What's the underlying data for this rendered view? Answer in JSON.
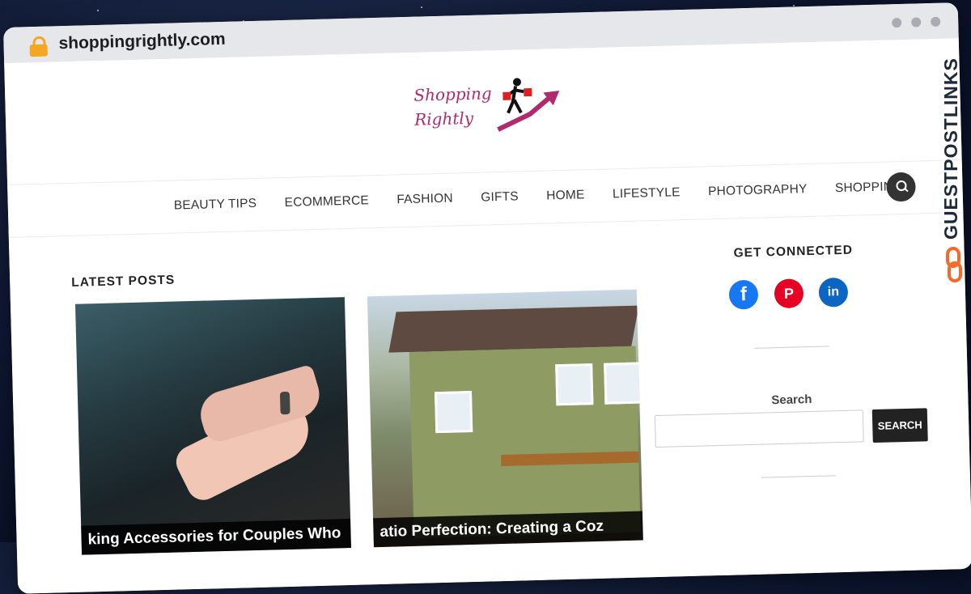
{
  "browser": {
    "url": "shoppingrightly.com"
  },
  "site": {
    "logo_line1": "Shopping",
    "logo_line2": "Rightly",
    "nav": [
      "BEAUTY TIPS",
      "ECOMMERCE",
      "FASHION",
      "GIFTS",
      "HOME",
      "LIFESTYLE",
      "PHOTOGRAPHY",
      "SHOPPING"
    ]
  },
  "main": {
    "latest_title": "LATEST POSTS",
    "posts": [
      {
        "caption": "king Accessories for Couples Who"
      },
      {
        "caption": "atio Perfection: Creating a Coz"
      }
    ]
  },
  "sidebar": {
    "connect_title": "GET CONNECTED",
    "social": [
      {
        "icon": "facebook-icon",
        "glyph": "f",
        "color": "#1877f2"
      },
      {
        "icon": "pinterest-icon",
        "glyph": "P",
        "color": "#e60023"
      },
      {
        "icon": "linkedin-icon",
        "glyph": "in",
        "color": "#0a66c2"
      }
    ],
    "search_label": "Search",
    "search_placeholder": "",
    "search_button": "SEARCH"
  },
  "watermark": {
    "text": "GUESTPOSTLINKS"
  }
}
